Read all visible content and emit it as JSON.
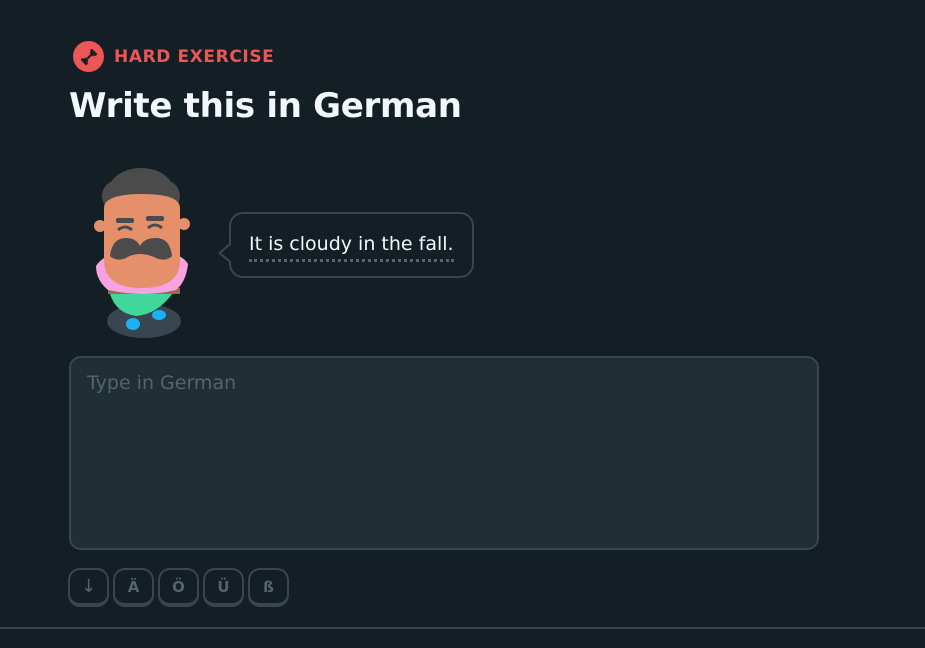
{
  "exercise": {
    "badge_label": "HARD EXERCISE",
    "badge_icon": "dumbbell-icon",
    "title": "Write this in German",
    "prompt_sentence": "It is cloudy in the fall.",
    "character": "mustached-man-character"
  },
  "answer": {
    "placeholder": "Type in German",
    "value": ""
  },
  "special_keys": [
    {
      "label": "↓",
      "icon": "arrow-down-icon"
    },
    {
      "label": "Ä"
    },
    {
      "label": "Ö"
    },
    {
      "label": "Ü"
    },
    {
      "label": "ß"
    }
  ],
  "colors": {
    "background": "#131f24",
    "accent_red": "#ee5555",
    "border": "#37464f",
    "input_bg": "#202f36",
    "text": "#f1f7fb",
    "muted": "#52656d"
  }
}
